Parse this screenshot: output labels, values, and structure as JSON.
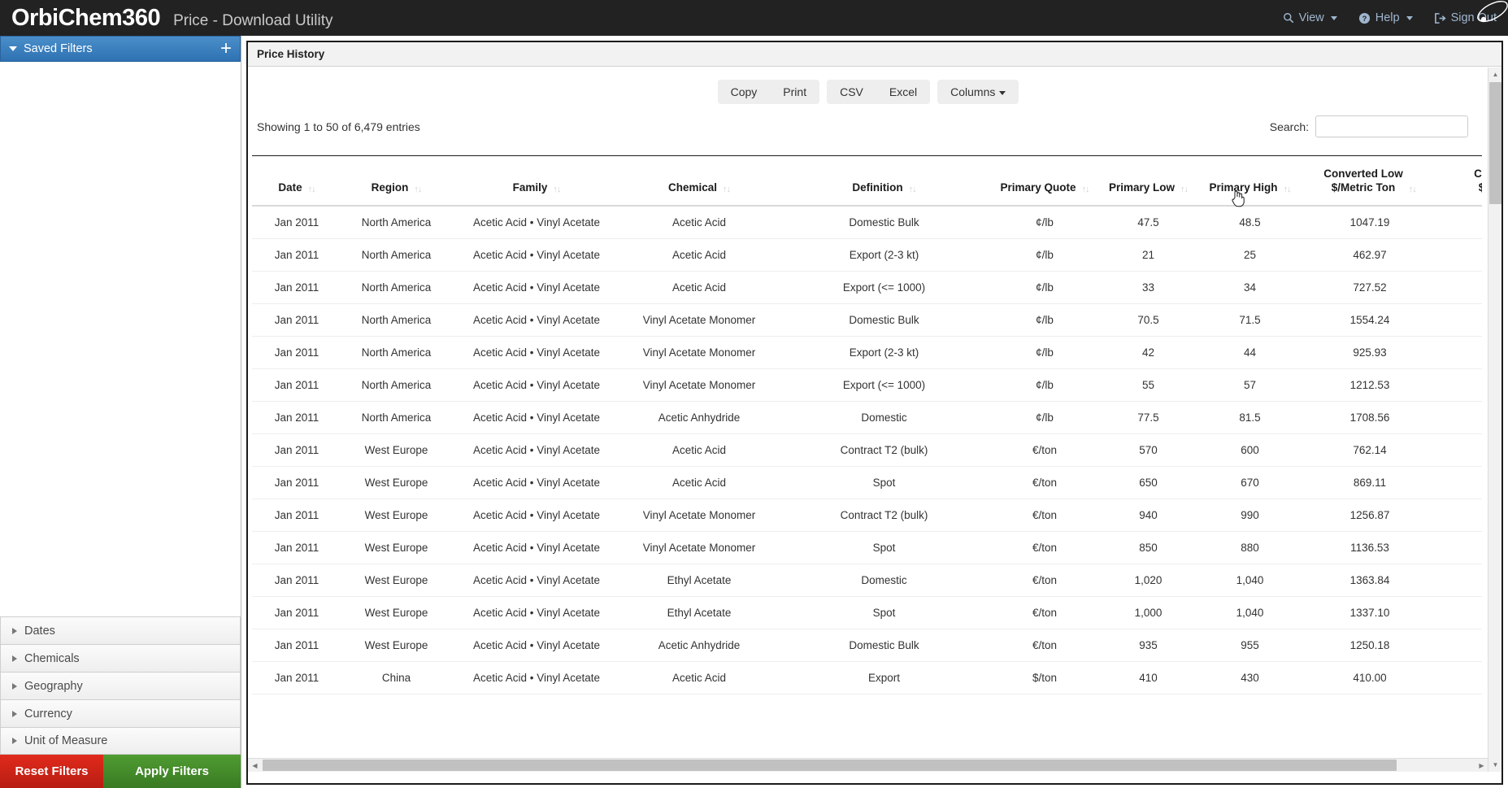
{
  "topbar": {
    "logo": "OrbiChem360",
    "app_title": "Price - Download Utility",
    "nav": [
      {
        "label": "View",
        "icon": "search-icon",
        "caret": true
      },
      {
        "label": "Help",
        "icon": "question-circle-icon",
        "caret": true
      },
      {
        "label": "Sign Out",
        "icon": "sign-out-icon",
        "caret": false
      }
    ]
  },
  "sidebar": {
    "saved_filters_label": "Saved Filters",
    "add_icon": "+",
    "sections": [
      {
        "label": "Dates"
      },
      {
        "label": "Chemicals"
      },
      {
        "label": "Geography"
      },
      {
        "label": "Currency"
      },
      {
        "label": "Unit of Measure"
      }
    ],
    "reset_label": "Reset Filters",
    "apply_label": "Apply Filters",
    "reset_color": "#c8231a",
    "apply_color": "#4a8f2c"
  },
  "panel": {
    "title": "Price History"
  },
  "toolbar": {
    "copy_label": "Copy",
    "print_label": "Print",
    "csv_label": "CSV",
    "excel_label": "Excel",
    "columns_label": "Columns"
  },
  "datatable": {
    "info": "Showing 1 to 50 of 6,479 entries",
    "search_label": "Search:",
    "search_value": "",
    "search_placeholder": "",
    "columns": [
      {
        "label": "Date",
        "sortable": true
      },
      {
        "label": "Region",
        "sortable": true
      },
      {
        "label": "Family",
        "sortable": true
      },
      {
        "label": "Chemical",
        "sortable": true
      },
      {
        "label": "Definition",
        "sortable": true
      },
      {
        "label": "Primary Quote",
        "sortable": true
      },
      {
        "label": "Primary Low",
        "sortable": true
      },
      {
        "label": "Primary High",
        "sortable": true
      },
      {
        "label": "Converted Low\n$/Metric Ton",
        "sortable": true
      },
      {
        "label": "Conv\n$/M",
        "sortable": true
      }
    ],
    "rows": [
      {
        "date": "Jan 2011",
        "region": "North America",
        "family": "Acetic Acid • Vinyl Acetate",
        "chemical": "Acetic Acid",
        "definition": "Domestic Bulk",
        "quote": "¢/lb",
        "low": "47.5",
        "high": "48.5",
        "converted_low": "1047.19"
      },
      {
        "date": "Jan 2011",
        "region": "North America",
        "family": "Acetic Acid • Vinyl Acetate",
        "chemical": "Acetic Acid",
        "definition": "Export (2-3 kt)",
        "quote": "¢/lb",
        "low": "21",
        "high": "25",
        "converted_low": "462.97"
      },
      {
        "date": "Jan 2011",
        "region": "North America",
        "family": "Acetic Acid • Vinyl Acetate",
        "chemical": "Acetic Acid",
        "definition": "Export (<= 1000)",
        "quote": "¢/lb",
        "low": "33",
        "high": "34",
        "converted_low": "727.52"
      },
      {
        "date": "Jan 2011",
        "region": "North America",
        "family": "Acetic Acid • Vinyl Acetate",
        "chemical": "Vinyl Acetate Monomer",
        "definition": "Domestic Bulk",
        "quote": "¢/lb",
        "low": "70.5",
        "high": "71.5",
        "converted_low": "1554.24"
      },
      {
        "date": "Jan 2011",
        "region": "North America",
        "family": "Acetic Acid • Vinyl Acetate",
        "chemical": "Vinyl Acetate Monomer",
        "definition": "Export (2-3 kt)",
        "quote": "¢/lb",
        "low": "42",
        "high": "44",
        "converted_low": "925.93"
      },
      {
        "date": "Jan 2011",
        "region": "North America",
        "family": "Acetic Acid • Vinyl Acetate",
        "chemical": "Vinyl Acetate Monomer",
        "definition": "Export (<= 1000)",
        "quote": "¢/lb",
        "low": "55",
        "high": "57",
        "converted_low": "1212.53"
      },
      {
        "date": "Jan 2011",
        "region": "North America",
        "family": "Acetic Acid • Vinyl Acetate",
        "chemical": "Acetic Anhydride",
        "definition": "Domestic",
        "quote": "¢/lb",
        "low": "77.5",
        "high": "81.5",
        "converted_low": "1708.56"
      },
      {
        "date": "Jan 2011",
        "region": "West Europe",
        "family": "Acetic Acid • Vinyl Acetate",
        "chemical": "Acetic Acid",
        "definition": "Contract T2 (bulk)",
        "quote": "€/ton",
        "low": "570",
        "high": "600",
        "converted_low": "762.14"
      },
      {
        "date": "Jan 2011",
        "region": "West Europe",
        "family": "Acetic Acid • Vinyl Acetate",
        "chemical": "Acetic Acid",
        "definition": "Spot",
        "quote": "€/ton",
        "low": "650",
        "high": "670",
        "converted_low": "869.11"
      },
      {
        "date": "Jan 2011",
        "region": "West Europe",
        "family": "Acetic Acid • Vinyl Acetate",
        "chemical": "Vinyl Acetate Monomer",
        "definition": "Contract T2 (bulk)",
        "quote": "€/ton",
        "low": "940",
        "high": "990",
        "converted_low": "1256.87"
      },
      {
        "date": "Jan 2011",
        "region": "West Europe",
        "family": "Acetic Acid • Vinyl Acetate",
        "chemical": "Vinyl Acetate Monomer",
        "definition": "Spot",
        "quote": "€/ton",
        "low": "850",
        "high": "880",
        "converted_low": "1136.53"
      },
      {
        "date": "Jan 2011",
        "region": "West Europe",
        "family": "Acetic Acid • Vinyl Acetate",
        "chemical": "Ethyl Acetate",
        "definition": "Domestic",
        "quote": "€/ton",
        "low": "1,020",
        "high": "1,040",
        "converted_low": "1363.84"
      },
      {
        "date": "Jan 2011",
        "region": "West Europe",
        "family": "Acetic Acid • Vinyl Acetate",
        "chemical": "Ethyl Acetate",
        "definition": "Spot",
        "quote": "€/ton",
        "low": "1,000",
        "high": "1,040",
        "converted_low": "1337.10"
      },
      {
        "date": "Jan 2011",
        "region": "West Europe",
        "family": "Acetic Acid • Vinyl Acetate",
        "chemical": "Acetic Anhydride",
        "definition": "Domestic Bulk",
        "quote": "€/ton",
        "low": "935",
        "high": "955",
        "converted_low": "1250.18"
      },
      {
        "date": "Jan 2011",
        "region": "China",
        "family": "Acetic Acid • Vinyl Acetate",
        "chemical": "Acetic Acid",
        "definition": "Export",
        "quote": "$/ton",
        "low": "410",
        "high": "430",
        "converted_low": "410.00"
      }
    ]
  }
}
